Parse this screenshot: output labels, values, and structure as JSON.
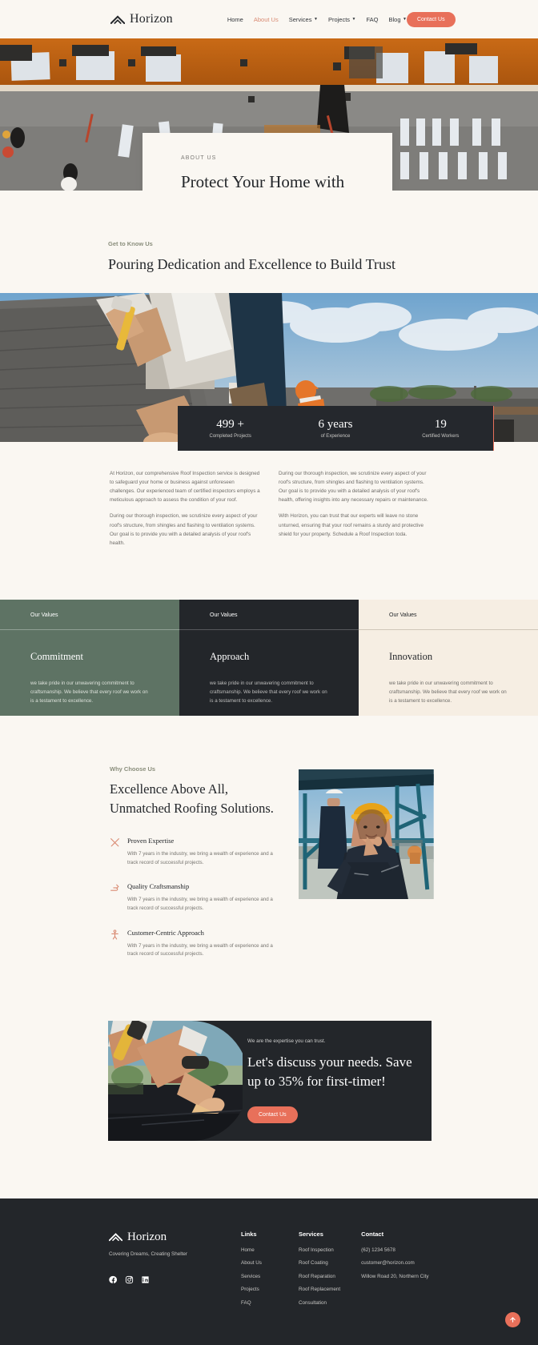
{
  "header": {
    "brand": "Horizon",
    "nav": [
      {
        "label": "Home",
        "caret": false,
        "active": false
      },
      {
        "label": "About Us",
        "caret": false,
        "active": true
      },
      {
        "label": "Services",
        "caret": true,
        "active": false
      },
      {
        "label": "Projects",
        "caret": true,
        "active": false
      },
      {
        "label": "FAQ",
        "caret": false,
        "active": false
      },
      {
        "label": "Blog",
        "caret": true,
        "active": false
      }
    ],
    "contact_button": "Contact Us"
  },
  "hero": {
    "eyebrow": "ABOUT US",
    "title": "Protect Your Home with Quality Roofing",
    "accent_color": "#E8705A"
  },
  "know": {
    "eyebrow": "Get to Know Us",
    "title": "Pouring Dedication and Excellence to Build Trust"
  },
  "stats": [
    {
      "value": "499 +",
      "label": "Completed Projects"
    },
    {
      "value": "6 years",
      "label": "of Experience"
    },
    {
      "value": "19",
      "label": "Certified Workers"
    }
  ],
  "copy": {
    "left": [
      "At Horizon, our comprehensive Roof Inspection service is designed to safeguard your home or business against unforeseen challenges. Our experienced team of certified inspectors employs a meticulous approach to assess the condition of your roof.",
      "During our thorough inspection, we scrutinize every aspect of your roof's structure, from shingles and flashing to ventilation systems. Our goal is to provide you with a detailed analysis of your roof's health."
    ],
    "right": [
      "During our thorough inspection, we scrutinize every aspect of your roof's structure, from shingles and flashing to ventilation systems. Our goal is to provide you with a detailed analysis of your roof's health, offering insights into any necessary repairs or maintenance.",
      "With Horizon, you can trust that our experts will leave no stone unturned, ensuring that your roof remains a sturdy and protective shield for your property. Schedule a Roof Inspection toda."
    ]
  },
  "values": [
    {
      "head": "Our Values",
      "title": "Commitment",
      "text": "we take pride in our unwavering commitment to craftsmanship. We believe that every roof we work on is a testament to excellence.",
      "bg": "#5E7364"
    },
    {
      "head": "Our Values",
      "title": "Approach",
      "text": "we take pride in our unwavering commitment to craftsmanship. We believe that every roof we work on is a testament to excellence.",
      "bg": "#23262A"
    },
    {
      "head": "Our Values",
      "title": "Innovation",
      "text": "we take pride in our unwavering commitment to craftsmanship. We believe that every roof we work on is a testament to excellence.",
      "bg": "#F6EEE3"
    }
  ],
  "why": {
    "eyebrow": "Why Choose Us",
    "title": "Excellence Above All, Unmatched Roofing Solutions.",
    "features": [
      {
        "icon": "crossed-tools-icon",
        "title": "Proven Expertise",
        "text": "With 7 years in the industry, we bring a wealth of experience and a track record of successful projects."
      },
      {
        "icon": "craftsmanship-hand-icon",
        "title": "Quality Craftsmanship",
        "text": "With 7 years in the industry, we bring a wealth of experience and a track record of successful projects."
      },
      {
        "icon": "person-icon",
        "title": "Customer-Centric Approach",
        "text": "With 7 years in the industry, we bring a wealth of experience and a track record of successful projects."
      }
    ]
  },
  "cta": {
    "eyebrow": "We are the expertise you can trust.",
    "title": "Let's discuss your needs. Save up to 35% for first-timer!",
    "button": "Contact Us"
  },
  "footer": {
    "brand": "Horizon",
    "tagline": "Covering Dreams, Creating Shelter",
    "socials": [
      "facebook-icon",
      "instagram-icon",
      "linkedin-icon"
    ],
    "links": {
      "head": "Links",
      "items": [
        "Home",
        "About Us",
        "Services",
        "Projects",
        "FAQ"
      ]
    },
    "services": {
      "head": "Services",
      "items": [
        "Roof Inspection",
        "Roof Coating",
        "Roof Reparation",
        "Roof Replacement",
        "Consultation"
      ]
    },
    "contact": {
      "head": "Contact",
      "items": [
        "(62) 1234 5678",
        "customer@horizon.com",
        "Willow Road 20, Northern City"
      ]
    }
  }
}
